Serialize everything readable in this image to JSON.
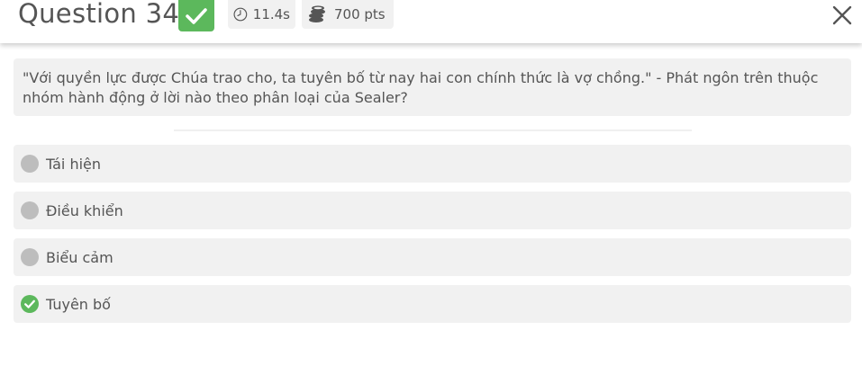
{
  "header": {
    "title": "Question 34",
    "time": "11.4s",
    "points": "700 pts"
  },
  "question": {
    "text": "\"Với quyền lực được Chúa trao cho, ta tuyên bố từ nay hai con chính thức là vợ chồng.\" - Phát ngôn trên thuộc nhóm hành động ở lời nào theo phân loại của Sealer?"
  },
  "options": [
    {
      "label": "Tái hiện",
      "state": "unselected"
    },
    {
      "label": "Điều khiển",
      "state": "unselected"
    },
    {
      "label": "Biểu cảm",
      "state": "unselected"
    },
    {
      "label": "Tuyên bố",
      "state": "correct"
    }
  ],
  "colors": {
    "correct": "#5cb85c",
    "option_bg": "#f1f1f1",
    "unselected_dot": "#bdbdbd",
    "text": "#555555"
  }
}
